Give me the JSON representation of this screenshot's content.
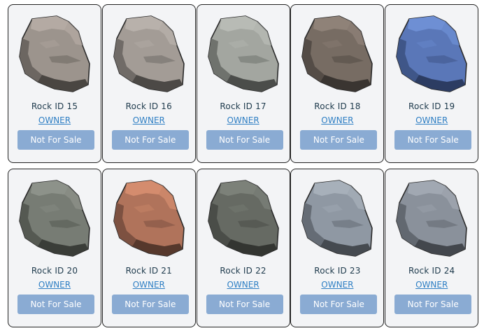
{
  "rocks": [
    {
      "id_label": "Rock ID 15",
      "owner_label": "OWNER",
      "sale_label": "Not For Sale",
      "color_light": "#b4aaa3",
      "color_mid": "#9c948d",
      "color_dark": "#6c6661",
      "color_deep": "#4a4642",
      "icon": "rock-icon"
    },
    {
      "id_label": "Rock ID 16",
      "owner_label": "OWNER",
      "sale_label": "Not For Sale",
      "color_light": "#b8b1ab",
      "color_mid": "#a39c96",
      "color_dark": "#706b67",
      "color_deep": "#4c4946",
      "icon": "rock-icon"
    },
    {
      "id_label": "Rock ID 17",
      "owner_label": "OWNER",
      "sale_label": "Not For Sale",
      "color_light": "#b8bbb5",
      "color_mid": "#a3a6a0",
      "color_dark": "#6f726d",
      "color_deep": "#4b4d4a",
      "icon": "rock-icon"
    },
    {
      "id_label": "Rock ID 18",
      "owner_label": "OWNER",
      "sale_label": "Not For Sale",
      "color_light": "#8f8278",
      "color_mid": "#776c63",
      "color_dark": "#544c46",
      "color_deep": "#3a3531",
      "icon": "rock-icon"
    },
    {
      "id_label": "Rock ID 19",
      "owner_label": "OWNER",
      "sale_label": "Not For Sale",
      "color_light": "#6e8fd4",
      "color_mid": "#5a77b8",
      "color_dark": "#3f5688",
      "color_deep": "#2c3c62",
      "icon": "rock-icon"
    },
    {
      "id_label": "Rock ID 20",
      "owner_label": "OWNER",
      "sale_label": "Not For Sale",
      "color_light": "#8d928a",
      "color_mid": "#777c74",
      "color_dark": "#555952",
      "color_deep": "#3a3d38",
      "icon": "rock-icon"
    },
    {
      "id_label": "Rock ID 21",
      "owner_label": "OWNER",
      "sale_label": "Not For Sale",
      "color_light": "#d48c6e",
      "color_mid": "#b0735b",
      "color_dark": "#7d5141",
      "color_deep": "#56382c",
      "icon": "rock-icon"
    },
    {
      "id_label": "Rock ID 22",
      "owner_label": "OWNER",
      "sale_label": "Not For Sale",
      "color_light": "#7c8179",
      "color_mid": "#666a63",
      "color_dark": "#4a4d48",
      "color_deep": "#333531",
      "icon": "rock-icon"
    },
    {
      "id_label": "Rock ID 23",
      "owner_label": "OWNER",
      "sale_label": "Not For Sale",
      "color_light": "#a7b0ba",
      "color_mid": "#8f98a3",
      "color_dark": "#656c75",
      "color_deep": "#454a50",
      "icon": "rock-icon"
    },
    {
      "id_label": "Rock ID 24",
      "owner_label": "OWNER",
      "sale_label": "Not For Sale",
      "color_light": "#a1a8b2",
      "color_mid": "#8a919b",
      "color_dark": "#626870",
      "color_deep": "#43474d",
      "icon": "rock-icon"
    }
  ],
  "theme": {
    "card_bg": "#f3f4f6",
    "button_bg": "#8aabd3",
    "link_color": "#2f7fc4",
    "id_text_color": "#1e3a4c"
  }
}
